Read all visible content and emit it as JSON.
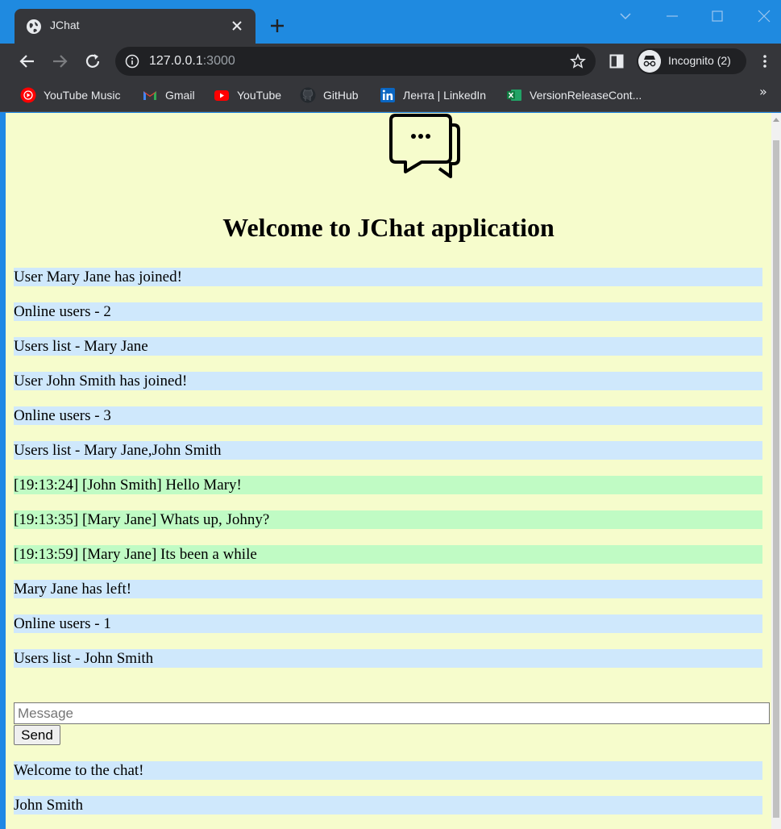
{
  "browser": {
    "tab_title": "JChat",
    "url_host": "127.0.0.1",
    "url_port": ":3000",
    "profile_label": "Incognito (2)",
    "bookmarks": [
      {
        "label": "YouTube Music",
        "icon": "youtube-music-icon"
      },
      {
        "label": "Gmail",
        "icon": "gmail-icon"
      },
      {
        "label": "YouTube",
        "icon": "youtube-icon"
      },
      {
        "label": "GitHub",
        "icon": "github-icon"
      },
      {
        "label": "Лента | LinkedIn",
        "icon": "linkedin-icon"
      },
      {
        "label": "VersionReleaseCont...",
        "icon": "excel-icon"
      }
    ],
    "bookmarks_more": "»"
  },
  "app": {
    "heading": "Welcome to JChat application",
    "messages": [
      {
        "text": "User Mary Jane has joined!",
        "kind": "system"
      },
      {
        "text": "Online users - 2",
        "kind": "system"
      },
      {
        "text": "Users list - Mary Jane",
        "kind": "system"
      },
      {
        "text": "User John Smith has joined!",
        "kind": "system"
      },
      {
        "text": "Online users - 3",
        "kind": "system"
      },
      {
        "text": "Users list - Mary Jane,John Smith",
        "kind": "system"
      },
      {
        "text": "[19:13:24] [John Smith] Hello Mary!",
        "kind": "chat"
      },
      {
        "text": "[19:13:35] [Mary Jane] Whats up, Johny?",
        "kind": "chat"
      },
      {
        "text": "[19:13:59] [Mary Jane] Its been a while",
        "kind": "chat"
      },
      {
        "text": "Mary Jane has left!",
        "kind": "system"
      },
      {
        "text": "Online users - 1",
        "kind": "system"
      },
      {
        "text": "Users list - John Smith",
        "kind": "system"
      }
    ],
    "input_placeholder": "Message",
    "input_value": "",
    "send_label": "Send",
    "footer": {
      "welcome": "Welcome to the chat!",
      "username": "John Smith"
    }
  },
  "colors": {
    "page_bg": "#f6fccc",
    "system_msg_bg": "#cfe8fc",
    "chat_msg_bg": "#c0fbc4"
  }
}
